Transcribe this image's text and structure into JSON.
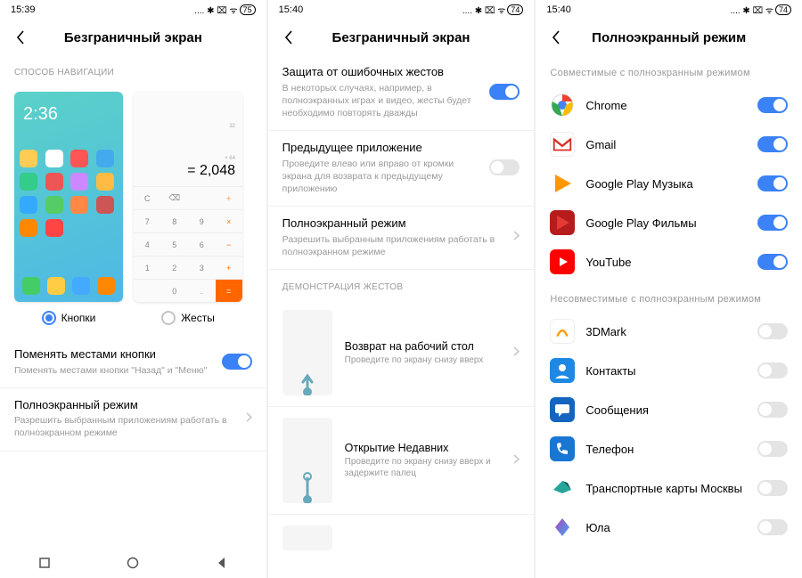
{
  "panel1": {
    "time": "15:39",
    "battery": "75",
    "title": "Безграничный экран",
    "section_nav": "СПОСОБ НАВИГАЦИИ",
    "opt_buttons": "Кнопки",
    "opt_gestures": "Жесты",
    "home_time": "2:36",
    "calc_ops1": "32",
    "calc_ops2": "× 64",
    "calc_result": "= 2,048",
    "swap_title": "Поменять местами кнопки",
    "swap_desc": "Поменять местами кнопки \"Назад\" и \"Меню\"",
    "fullscreen_title": "Полноэкранный режим",
    "fullscreen_desc": "Разрешить выбранным приложениям работать в полноэкранном режиме"
  },
  "panel2": {
    "time": "15:40",
    "battery": "74",
    "title": "Безграничный экран",
    "protect_title": "Защита от ошибочных жестов",
    "protect_desc": "В некоторых случаях, например, в полноэкранных играх и видео, жесты будет необходимо повторять дважды",
    "prev_title": "Предыдущее приложение",
    "prev_desc": "Проведите влево или вправо от кромки экрана для возврата к предыдущему приложению",
    "fullscreen_title": "Полноэкранный режим",
    "fullscreen_desc": "Разрешить выбранным приложениям работать в полноэкранном режиме",
    "section_demo": "ДЕМОНСТРАЦИЯ ЖЕСТОВ",
    "gesture1_title": "Возврат на рабочий стол",
    "gesture1_desc": "Проведите по экрану снизу вверх",
    "gesture2_title": "Открытие Недавних",
    "gesture2_desc": "Проведите по экрану снизу вверх и задержите палец"
  },
  "panel3": {
    "time": "15:40",
    "battery": "74",
    "title": "Полноэкранный режим",
    "section_compat": "Совместимые с полноэкранным режимом",
    "section_incompat": "Несовместимые с полноэкранным режимом",
    "apps_compat": [
      {
        "name": "Chrome",
        "color": "#fff"
      },
      {
        "name": "Gmail",
        "color": "#fff"
      },
      {
        "name": "Google Play Музыка",
        "color": "#f90"
      },
      {
        "name": "Google Play Фильмы",
        "color": "#c22"
      },
      {
        "name": "YouTube",
        "color": "#f00"
      }
    ],
    "apps_incompat": [
      {
        "name": "3DMark"
      },
      {
        "name": "Контакты"
      },
      {
        "name": "Сообщения"
      },
      {
        "name": "Телефон"
      },
      {
        "name": "Транспортные карты Москвы"
      },
      {
        "name": "Юла"
      }
    ]
  }
}
